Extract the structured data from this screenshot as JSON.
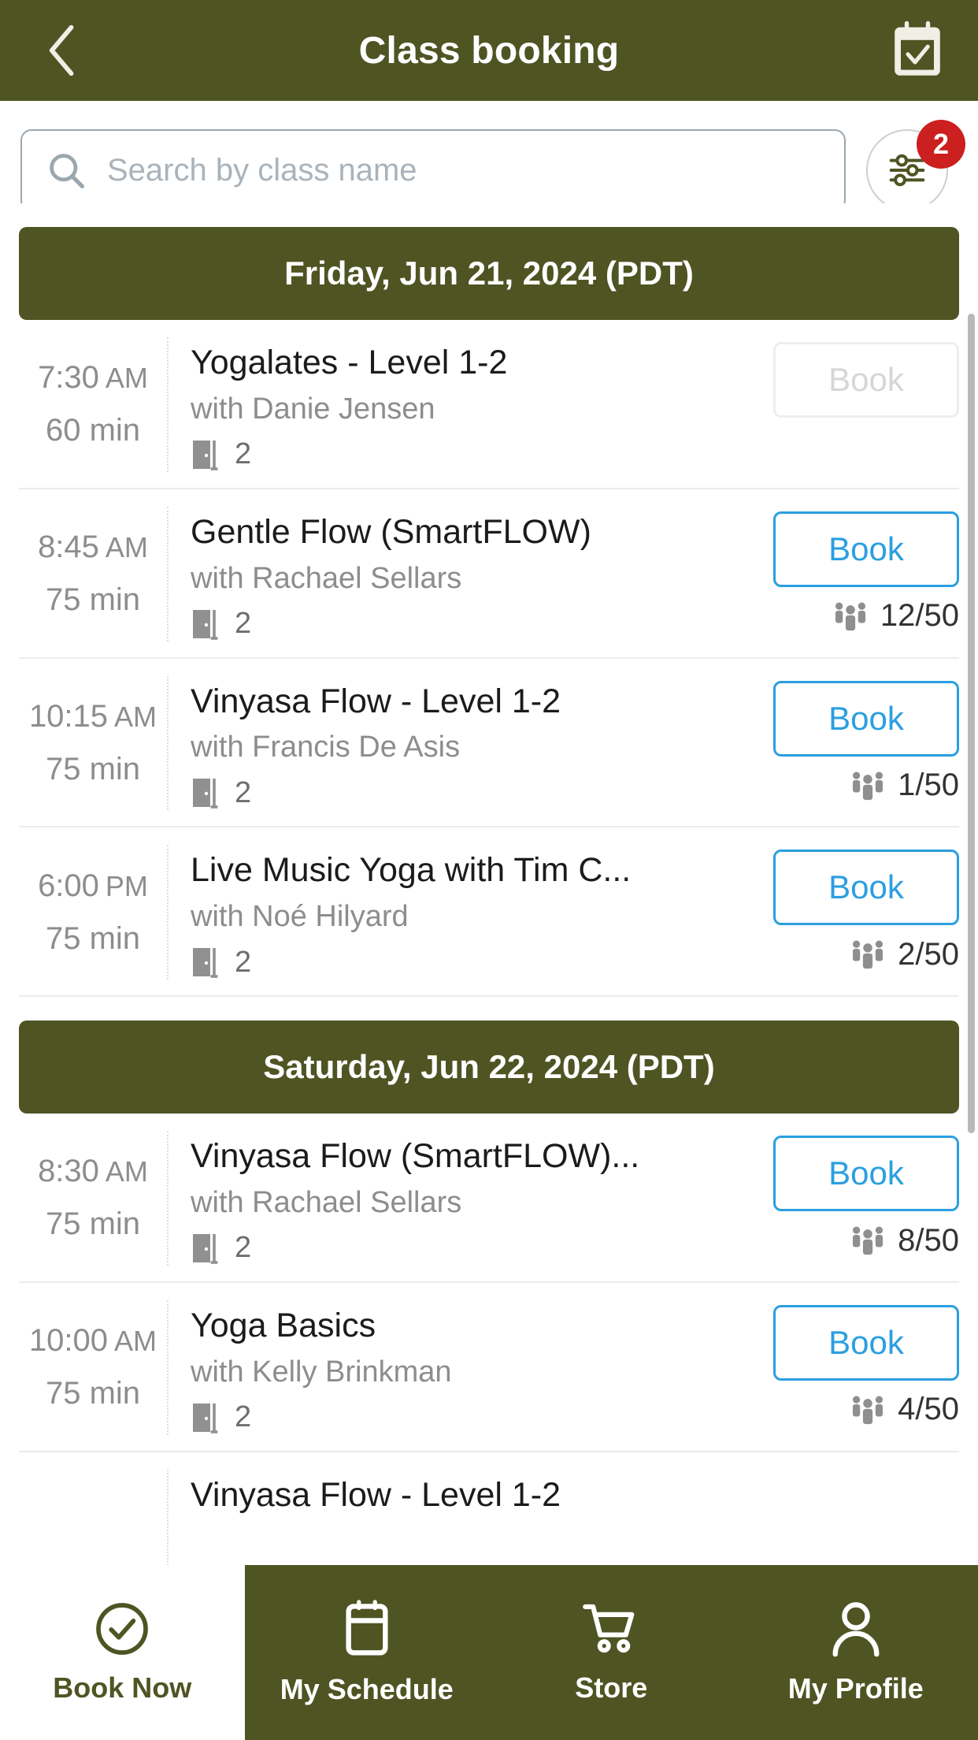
{
  "header": {
    "title": "Class booking",
    "back_icon": "chevron-left-icon",
    "action_icon": "calendar-check-icon"
  },
  "search": {
    "placeholder": "Search by class name",
    "value": "",
    "search_icon": "search-icon",
    "filter_icon": "sliders-filter-icon",
    "filter_badge": "2"
  },
  "days": [
    {
      "label": "Friday, Jun 21, 2024 (PDT)",
      "classes": [
        {
          "time": "7:30",
          "ampm": "AM",
          "duration": "60 min",
          "title": "Yogalates - Level 1-2",
          "teacher": "with Danie Jensen",
          "room": "2",
          "book_label": "Book",
          "book_enabled": false,
          "capacity": ""
        },
        {
          "time": "8:45",
          "ampm": "AM",
          "duration": "75 min",
          "title": "Gentle Flow (SmartFLOW)",
          "teacher": "with Rachael Sellars",
          "room": "2",
          "book_label": "Book",
          "book_enabled": true,
          "capacity": "12/50"
        },
        {
          "time": "10:15",
          "ampm": "AM",
          "duration": "75 min",
          "title": "Vinyasa Flow - Level 1-2",
          "teacher": "with Francis De Asis",
          "room": "2",
          "book_label": "Book",
          "book_enabled": true,
          "capacity": "1/50"
        },
        {
          "time": "6:00",
          "ampm": "PM",
          "duration": "75 min",
          "title": "Live Music Yoga with Tim C...",
          "teacher": "with Noé Hilyard",
          "room": "2",
          "book_label": "Book",
          "book_enabled": true,
          "capacity": "2/50"
        }
      ]
    },
    {
      "label": "Saturday, Jun 22, 2024 (PDT)",
      "classes": [
        {
          "time": "8:30",
          "ampm": "AM",
          "duration": "75 min",
          "title": "Vinyasa Flow (SmartFLOW)...",
          "teacher": "with Rachael Sellars",
          "room": "2",
          "book_label": "Book",
          "book_enabled": true,
          "capacity": "8/50"
        },
        {
          "time": "10:00",
          "ampm": "AM",
          "duration": "75 min",
          "title": "Yoga Basics",
          "teacher": "with Kelly Brinkman",
          "room": "2",
          "book_label": "Book",
          "book_enabled": true,
          "capacity": "4/50"
        },
        {
          "time": "",
          "ampm": "",
          "duration": "",
          "title": "Vinyasa Flow - Level 1-2",
          "teacher": "",
          "room": "",
          "book_label": "",
          "book_enabled": true,
          "capacity": ""
        }
      ]
    }
  ],
  "bottom_nav": [
    {
      "label": "Book Now",
      "icon": "check-circle-icon",
      "active": true
    },
    {
      "label": "My Schedule",
      "icon": "calendar-icon",
      "active": false
    },
    {
      "label": "Store",
      "icon": "cart-icon",
      "active": false
    },
    {
      "label": "My Profile",
      "icon": "person-icon",
      "active": false
    }
  ],
  "colors": {
    "brand_olive": "#4f5423",
    "accent_blue": "#2a9fe0",
    "badge_red": "#cc1f1f"
  }
}
